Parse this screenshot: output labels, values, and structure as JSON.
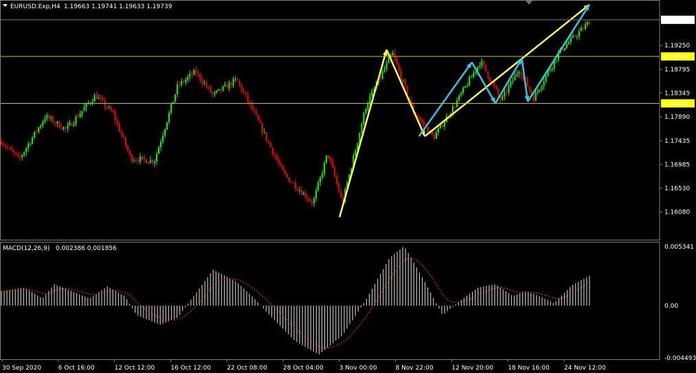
{
  "symbol_header": {
    "symbol": "EURUSD.Exp,H4",
    "ohlc": "1.19663 1.19741 1.19633 1.19739"
  },
  "macd_header": {
    "label": "MACD(12,26,9)",
    "values": "0.002386 0.001856"
  },
  "colors": {
    "background": "#000000",
    "bull_candle": "#00ff00",
    "bear_candle": "#ff0000",
    "level_line": "#c8c800",
    "yellow_arrow": "#ffff40",
    "cyan_arrow": "#30c8e6",
    "macd_hist": "#c0c0c0",
    "signal_line": "#ff3030",
    "current_price_label": "#ffffff",
    "level_label": "#ffff00"
  },
  "chart_data": [
    {
      "type": "candlestick",
      "title": "EURUSD.Exp,H4",
      "price_axis_ticks": [
        "1.19250",
        "1.18795",
        "1.18345",
        "1.17890",
        "1.17435",
        "1.16985",
        "1.16530",
        "1.16080"
      ],
      "ylim": [
        1.1555,
        1.2009
      ],
      "time_axis_ticks": [
        "30 Sep 2020",
        "6 Oct 16:00",
        "12 Oct 12:00",
        "16 Oct 12:00",
        "22 Oct 08:00",
        "28 Oct 04:00",
        "3 Nov 00:00",
        "8 Nov 22:00",
        "12 Nov 20:00",
        "18 Nov 16:00",
        "24 Nov 12:00"
      ],
      "current_price": "1.19739",
      "horizontal_levels": [
        "1.19041",
        "1.18147"
      ],
      "close_path": [
        {
          "t": 0,
          "price": 1.1742
        },
        {
          "t": 0.03,
          "price": 1.1708
        },
        {
          "t": 0.075,
          "price": 1.179
        },
        {
          "t": 0.11,
          "price": 1.1765
        },
        {
          "t": 0.16,
          "price": 1.183
        },
        {
          "t": 0.19,
          "price": 1.1795
        },
        {
          "t": 0.22,
          "price": 1.171
        },
        {
          "t": 0.26,
          "price": 1.1705
        },
        {
          "t": 0.3,
          "price": 1.1848
        },
        {
          "t": 0.33,
          "price": 1.1875
        },
        {
          "t": 0.36,
          "price": 1.183
        },
        {
          "t": 0.4,
          "price": 1.186
        },
        {
          "t": 0.43,
          "price": 1.1795
        },
        {
          "t": 0.48,
          "price": 1.168
        },
        {
          "t": 0.53,
          "price": 1.1625
        },
        {
          "t": 0.555,
          "price": 1.172
        },
        {
          "t": 0.58,
          "price": 1.1625
        },
        {
          "t": 0.62,
          "price": 1.181
        },
        {
          "t": 0.665,
          "price": 1.191
        },
        {
          "t": 0.7,
          "price": 1.18
        },
        {
          "t": 0.735,
          "price": 1.175
        },
        {
          "t": 0.77,
          "price": 1.181
        },
        {
          "t": 0.815,
          "price": 1.1895
        },
        {
          "t": 0.85,
          "price": 1.182
        },
        {
          "t": 0.88,
          "price": 1.188
        },
        {
          "t": 0.905,
          "price": 1.1825
        },
        {
          "t": 0.95,
          "price": 1.1915
        },
        {
          "t": 1.0,
          "price": 1.197
        }
      ],
      "annotations": {
        "yellow_arrows": [
          [
            {
              "t": 0.575,
              "price": 1.1598
            },
            {
              "t": 0.655,
              "price": 1.1917
            }
          ],
          [
            {
              "t": 0.655,
              "price": 1.1917
            },
            {
              "t": 0.72,
              "price": 1.1752
            }
          ],
          [
            {
              "t": 0.72,
              "price": 1.1752
            },
            {
              "t": 1.0,
              "price": 1.2003
            }
          ]
        ],
        "cyan_arrows": [
          [
            {
              "t": 0.71,
              "price": 1.1752
            },
            {
              "t": 0.8,
              "price": 1.1893
            }
          ],
          [
            {
              "t": 0.8,
              "price": 1.1893
            },
            {
              "t": 0.84,
              "price": 1.1815
            }
          ],
          [
            {
              "t": 0.84,
              "price": 1.1815
            },
            {
              "t": 0.885,
              "price": 1.19
            }
          ],
          [
            {
              "t": 0.885,
              "price": 1.19
            },
            {
              "t": 0.895,
              "price": 1.1818
            }
          ],
          [
            {
              "t": 0.895,
              "price": 1.1818
            },
            {
              "t": 1.0,
              "price": 1.2003
            }
          ]
        ]
      }
    },
    {
      "type": "bar",
      "title": "MACD(12,26,9)",
      "axis_ticks": [
        "0.005341",
        "0.00",
        "-0.004493"
      ],
      "ylim": [
        -0.004493,
        0.005341
      ],
      "macd_path": [
        {
          "t": 0,
          "v": 0.0012
        },
        {
          "t": 0.04,
          "v": 0.0015
        },
        {
          "t": 0.07,
          "v": 0.0006
        },
        {
          "t": 0.09,
          "v": 0.0018
        },
        {
          "t": 0.12,
          "v": 0.0012
        },
        {
          "t": 0.15,
          "v": 0.0006
        },
        {
          "t": 0.18,
          "v": 0.0016
        },
        {
          "t": 0.21,
          "v": 0.0008
        },
        {
          "t": 0.23,
          "v": -0.0008
        },
        {
          "t": 0.27,
          "v": -0.0016
        },
        {
          "t": 0.3,
          "v": -0.001
        },
        {
          "t": 0.33,
          "v": 0.001
        },
        {
          "t": 0.36,
          "v": 0.003
        },
        {
          "t": 0.4,
          "v": 0.002
        },
        {
          "t": 0.43,
          "v": 0.0006
        },
        {
          "t": 0.46,
          "v": -0.001
        },
        {
          "t": 0.5,
          "v": -0.003
        },
        {
          "t": 0.54,
          "v": -0.0041
        },
        {
          "t": 0.58,
          "v": -0.0025
        },
        {
          "t": 0.62,
          "v": 0.0005
        },
        {
          "t": 0.66,
          "v": 0.004
        },
        {
          "t": 0.685,
          "v": 0.005
        },
        {
          "t": 0.72,
          "v": 0.002
        },
        {
          "t": 0.75,
          "v": -0.0008
        },
        {
          "t": 0.78,
          "v": 0.0004
        },
        {
          "t": 0.81,
          "v": 0.0015
        },
        {
          "t": 0.84,
          "v": 0.0018
        },
        {
          "t": 0.87,
          "v": 0.0008
        },
        {
          "t": 0.89,
          "v": 0.0012
        },
        {
          "t": 0.91,
          "v": 0.0009
        },
        {
          "t": 0.94,
          "v": 0.0002
        },
        {
          "t": 0.97,
          "v": 0.0017
        },
        {
          "t": 1.0,
          "v": 0.0025
        }
      ]
    }
  ]
}
